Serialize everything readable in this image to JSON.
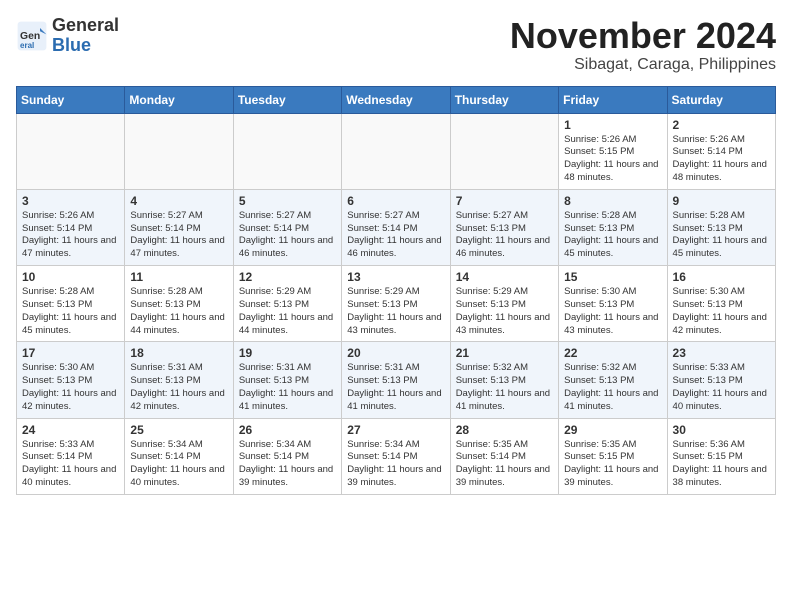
{
  "logo": {
    "general": "General",
    "blue": "Blue"
  },
  "header": {
    "month": "November 2024",
    "location": "Sibagat, Caraga, Philippines"
  },
  "weekdays": [
    "Sunday",
    "Monday",
    "Tuesday",
    "Wednesday",
    "Thursday",
    "Friday",
    "Saturday"
  ],
  "weeks": [
    [
      {
        "day": "",
        "info": ""
      },
      {
        "day": "",
        "info": ""
      },
      {
        "day": "",
        "info": ""
      },
      {
        "day": "",
        "info": ""
      },
      {
        "day": "",
        "info": ""
      },
      {
        "day": "1",
        "sunrise": "Sunrise: 5:26 AM",
        "sunset": "Sunset: 5:15 PM",
        "daylight": "Daylight: 11 hours and 48 minutes."
      },
      {
        "day": "2",
        "sunrise": "Sunrise: 5:26 AM",
        "sunset": "Sunset: 5:14 PM",
        "daylight": "Daylight: 11 hours and 48 minutes."
      }
    ],
    [
      {
        "day": "3",
        "sunrise": "Sunrise: 5:26 AM",
        "sunset": "Sunset: 5:14 PM",
        "daylight": "Daylight: 11 hours and 47 minutes."
      },
      {
        "day": "4",
        "sunrise": "Sunrise: 5:27 AM",
        "sunset": "Sunset: 5:14 PM",
        "daylight": "Daylight: 11 hours and 47 minutes."
      },
      {
        "day": "5",
        "sunrise": "Sunrise: 5:27 AM",
        "sunset": "Sunset: 5:14 PM",
        "daylight": "Daylight: 11 hours and 46 minutes."
      },
      {
        "day": "6",
        "sunrise": "Sunrise: 5:27 AM",
        "sunset": "Sunset: 5:14 PM",
        "daylight": "Daylight: 11 hours and 46 minutes."
      },
      {
        "day": "7",
        "sunrise": "Sunrise: 5:27 AM",
        "sunset": "Sunset: 5:13 PM",
        "daylight": "Daylight: 11 hours and 46 minutes."
      },
      {
        "day": "8",
        "sunrise": "Sunrise: 5:28 AM",
        "sunset": "Sunset: 5:13 PM",
        "daylight": "Daylight: 11 hours and 45 minutes."
      },
      {
        "day": "9",
        "sunrise": "Sunrise: 5:28 AM",
        "sunset": "Sunset: 5:13 PM",
        "daylight": "Daylight: 11 hours and 45 minutes."
      }
    ],
    [
      {
        "day": "10",
        "sunrise": "Sunrise: 5:28 AM",
        "sunset": "Sunset: 5:13 PM",
        "daylight": "Daylight: 11 hours and 45 minutes."
      },
      {
        "day": "11",
        "sunrise": "Sunrise: 5:28 AM",
        "sunset": "Sunset: 5:13 PM",
        "daylight": "Daylight: 11 hours and 44 minutes."
      },
      {
        "day": "12",
        "sunrise": "Sunrise: 5:29 AM",
        "sunset": "Sunset: 5:13 PM",
        "daylight": "Daylight: 11 hours and 44 minutes."
      },
      {
        "day": "13",
        "sunrise": "Sunrise: 5:29 AM",
        "sunset": "Sunset: 5:13 PM",
        "daylight": "Daylight: 11 hours and 43 minutes."
      },
      {
        "day": "14",
        "sunrise": "Sunrise: 5:29 AM",
        "sunset": "Sunset: 5:13 PM",
        "daylight": "Daylight: 11 hours and 43 minutes."
      },
      {
        "day": "15",
        "sunrise": "Sunrise: 5:30 AM",
        "sunset": "Sunset: 5:13 PM",
        "daylight": "Daylight: 11 hours and 43 minutes."
      },
      {
        "day": "16",
        "sunrise": "Sunrise: 5:30 AM",
        "sunset": "Sunset: 5:13 PM",
        "daylight": "Daylight: 11 hours and 42 minutes."
      }
    ],
    [
      {
        "day": "17",
        "sunrise": "Sunrise: 5:30 AM",
        "sunset": "Sunset: 5:13 PM",
        "daylight": "Daylight: 11 hours and 42 minutes."
      },
      {
        "day": "18",
        "sunrise": "Sunrise: 5:31 AM",
        "sunset": "Sunset: 5:13 PM",
        "daylight": "Daylight: 11 hours and 42 minutes."
      },
      {
        "day": "19",
        "sunrise": "Sunrise: 5:31 AM",
        "sunset": "Sunset: 5:13 PM",
        "daylight": "Daylight: 11 hours and 41 minutes."
      },
      {
        "day": "20",
        "sunrise": "Sunrise: 5:31 AM",
        "sunset": "Sunset: 5:13 PM",
        "daylight": "Daylight: 11 hours and 41 minutes."
      },
      {
        "day": "21",
        "sunrise": "Sunrise: 5:32 AM",
        "sunset": "Sunset: 5:13 PM",
        "daylight": "Daylight: 11 hours and 41 minutes."
      },
      {
        "day": "22",
        "sunrise": "Sunrise: 5:32 AM",
        "sunset": "Sunset: 5:13 PM",
        "daylight": "Daylight: 11 hours and 41 minutes."
      },
      {
        "day": "23",
        "sunrise": "Sunrise: 5:33 AM",
        "sunset": "Sunset: 5:13 PM",
        "daylight": "Daylight: 11 hours and 40 minutes."
      }
    ],
    [
      {
        "day": "24",
        "sunrise": "Sunrise: 5:33 AM",
        "sunset": "Sunset: 5:14 PM",
        "daylight": "Daylight: 11 hours and 40 minutes."
      },
      {
        "day": "25",
        "sunrise": "Sunrise: 5:34 AM",
        "sunset": "Sunset: 5:14 PM",
        "daylight": "Daylight: 11 hours and 40 minutes."
      },
      {
        "day": "26",
        "sunrise": "Sunrise: 5:34 AM",
        "sunset": "Sunset: 5:14 PM",
        "daylight": "Daylight: 11 hours and 39 minutes."
      },
      {
        "day": "27",
        "sunrise": "Sunrise: 5:34 AM",
        "sunset": "Sunset: 5:14 PM",
        "daylight": "Daylight: 11 hours and 39 minutes."
      },
      {
        "day": "28",
        "sunrise": "Sunrise: 5:35 AM",
        "sunset": "Sunset: 5:14 PM",
        "daylight": "Daylight: 11 hours and 39 minutes."
      },
      {
        "day": "29",
        "sunrise": "Sunrise: 5:35 AM",
        "sunset": "Sunset: 5:15 PM",
        "daylight": "Daylight: 11 hours and 39 minutes."
      },
      {
        "day": "30",
        "sunrise": "Sunrise: 5:36 AM",
        "sunset": "Sunset: 5:15 PM",
        "daylight": "Daylight: 11 hours and 38 minutes."
      }
    ]
  ]
}
